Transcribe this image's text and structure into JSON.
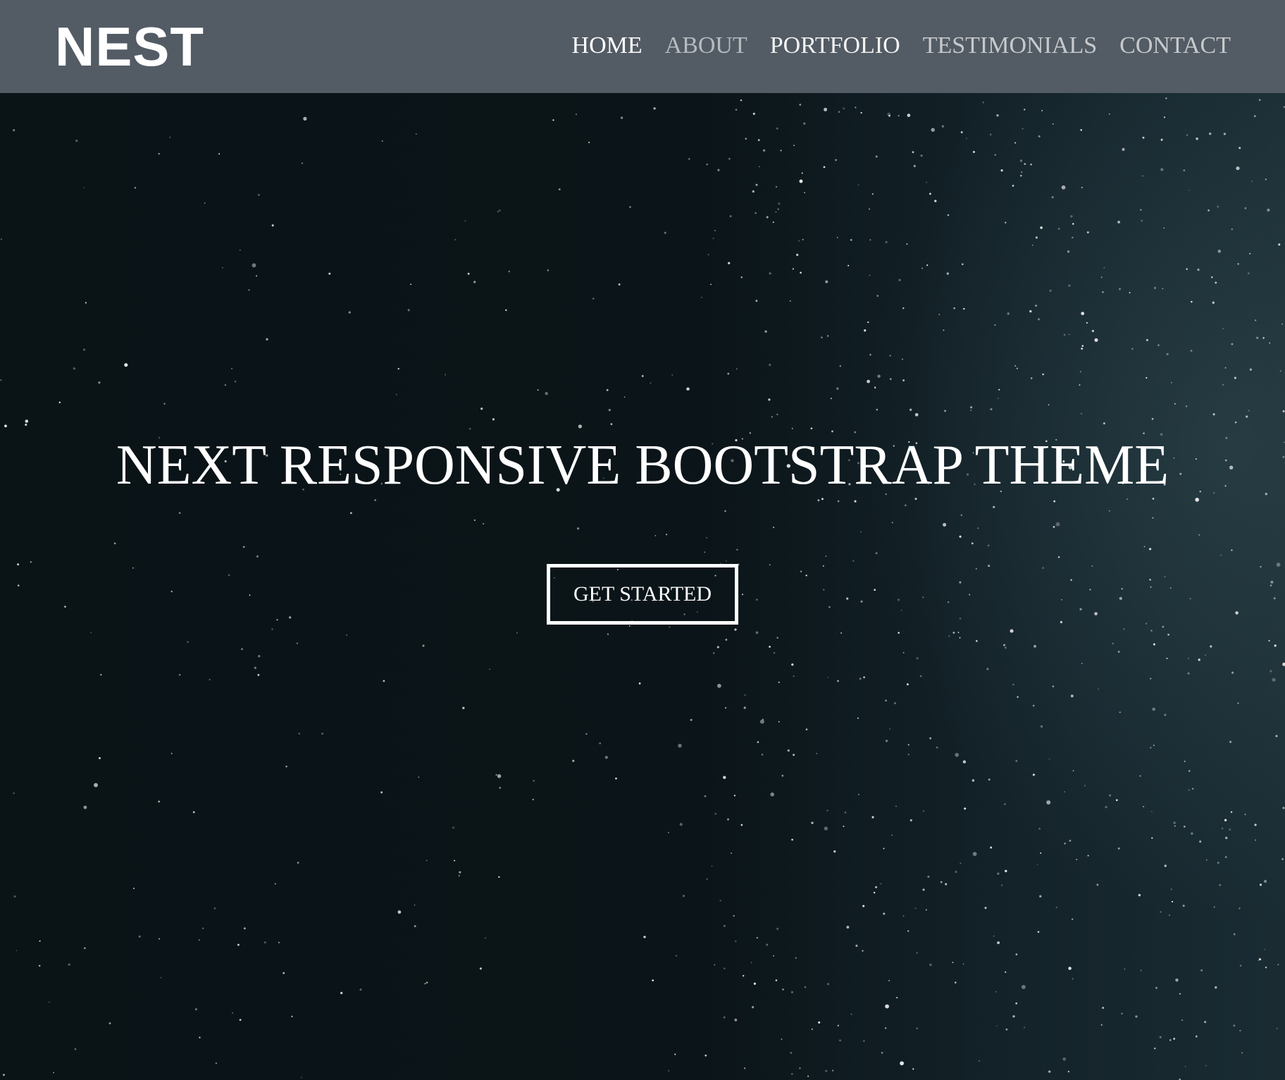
{
  "header": {
    "brand": "NEST",
    "nav": [
      {
        "label": "HOME",
        "color": "#ffffff"
      },
      {
        "label": "ABOUT",
        "color": "#b6bbbf"
      },
      {
        "label": "PORTFOLIO",
        "color": "#f2f2f2"
      },
      {
        "label": "TESTIMONIALS",
        "color": "#c6cacd"
      },
      {
        "label": "CONTACT",
        "color": "#c6cacd"
      }
    ],
    "background": "#535b64"
  },
  "hero": {
    "title": "NEXT RESPONSIVE BOOTSTRAP THEME",
    "cta_label": "GET STARTED",
    "background": "#0a1417"
  }
}
